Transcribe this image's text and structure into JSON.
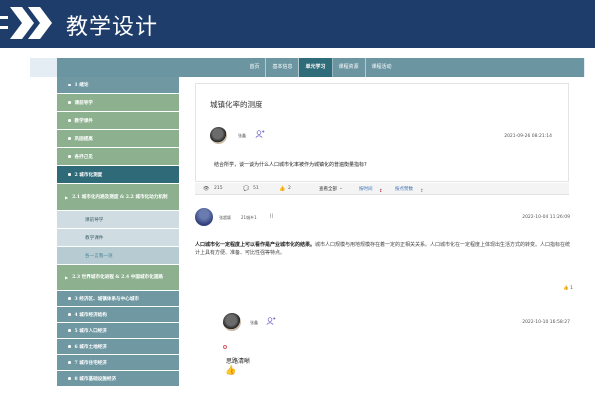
{
  "banner": {
    "title": "教学设计"
  },
  "nav": {
    "tabs": [
      "首页",
      "基本信息",
      "单元学习",
      "课程资源",
      "课程活动"
    ],
    "active_index": 2
  },
  "sidebar": {
    "items": [
      {
        "label": "1 绪论"
      },
      {
        "label": "课前导学"
      },
      {
        "label": "教学课件"
      },
      {
        "label": "巩固提高"
      },
      {
        "label": "各抒己见"
      },
      {
        "label": "2 城市化测度"
      },
      {
        "label": "2.1 城市化内涵及测度 & 2.2 城市化动力机制"
      },
      {
        "label": "课前导学"
      },
      {
        "label": "教学课件"
      },
      {
        "label": "各一言我一语"
      },
      {
        "label": "2.3 世界城市化进程 & 2.4 中国城市化道路"
      },
      {
        "label": "3 经济区、城镇体系与中心城市"
      },
      {
        "label": "4 城市经济结构"
      },
      {
        "label": "5 城市人口经济"
      },
      {
        "label": "6 城市土地经济"
      },
      {
        "label": "7 城市住宅经济"
      },
      {
        "label": "8 城市基础设施经济"
      }
    ]
  },
  "question": {
    "title": "城镇化率的测度",
    "author": "张鑫",
    "time": "2021-09-26 08:21:14",
    "text": "结合所学，谈一谈为什么人口城市化率被作为城镇化的普遍衡量指标?"
  },
  "stats": {
    "views": "215",
    "comments": "51",
    "likes": "2",
    "view_all": "查看全部",
    "sort_time": "按时间",
    "sort_likes": "按点赞数"
  },
  "answer": {
    "author": "张超颖",
    "class": "21城乡1",
    "bracket": "||",
    "time": "2022-10-04 11:26:09",
    "text_bold": "人口城市化一定程度上可以看作是产业城市化的结果。",
    "text_rest": "城市人口规模与用地规模存在着一定的正相关关系。人口城市化在一定程度上体现出生活方式的转变。人口指标在统计上具有方便、准备、可比性强等特点。",
    "likes": "1"
  },
  "reply": {
    "author": "张鑫",
    "time": "2022-10-10 16:58:27",
    "text": "思路清晰",
    "emoji": "👍"
  },
  "colors": {
    "banner": "#1f3d6b",
    "nav": "#6b95a0",
    "nav_active": "#2f6c7a",
    "sidebar_green": "#8db18f",
    "sidebar_blue": "#6f98a3",
    "sidebar_active": "#2f6a78",
    "sidebar_sub": "#cfdde3"
  },
  "icons": [
    "chevron-logo-icon",
    "avatar-icon",
    "friend-icon",
    "eye-icon",
    "comment-icon",
    "thumbs-up-icon",
    "sort-arrow-icon",
    "bullet-icon",
    "triangle-icon"
  ]
}
